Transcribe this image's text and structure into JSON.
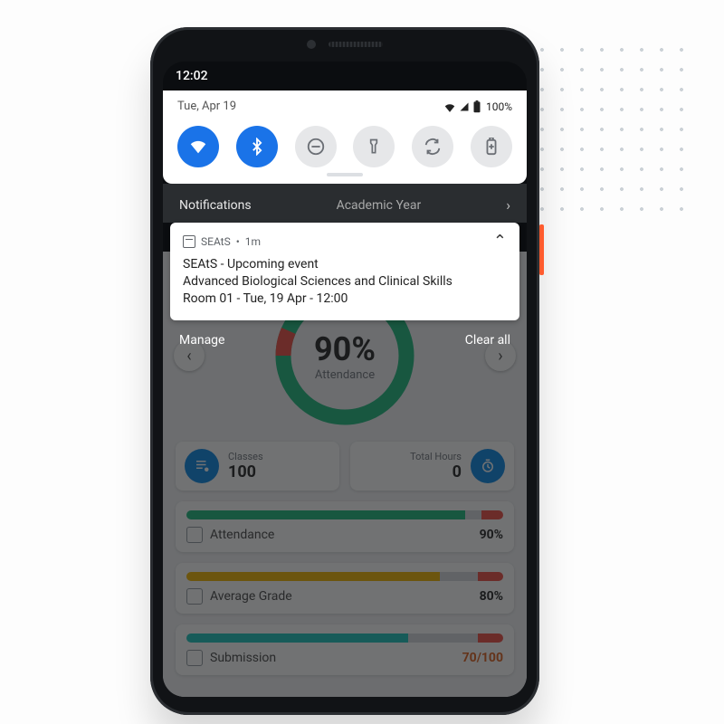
{
  "statusbar": {
    "time": "12:02"
  },
  "quicksettings": {
    "date": "Tue, Apr 19",
    "battery": "100%",
    "tiles": [
      {
        "name": "wifi-tile",
        "on": true
      },
      {
        "name": "bluetooth-tile",
        "on": true
      },
      {
        "name": "dnd-tile",
        "on": false
      },
      {
        "name": "flashlight-tile",
        "on": false
      },
      {
        "name": "rotate-tile",
        "on": false
      },
      {
        "name": "battery-saver-tile",
        "on": false
      }
    ]
  },
  "notifications": {
    "header_label": "Notifications",
    "background_tab": "Academic Year",
    "manage": "Manage",
    "clear_all": "Clear all",
    "card": {
      "app": "SEAtS",
      "age": "1m",
      "title": "SEAtS - Upcoming event",
      "line2": "Advanced Biological Sciences and Clinical Skills",
      "line3": "Room 01 - Tue, 19 Apr - 12:00"
    }
  },
  "dashboard": {
    "gauge": {
      "value": "90%",
      "label": "Attendance"
    },
    "stats": {
      "classes": {
        "label": "Classes",
        "value": "100"
      },
      "hours": {
        "label": "Total Hours",
        "value": "0"
      }
    },
    "metrics": [
      {
        "name": "Attendance",
        "value": "90%",
        "green": 0.88,
        "gray": 0.05,
        "red": 0.07
      },
      {
        "name": "Average Grade",
        "value": "80%",
        "yellow": 0.8,
        "gray": 0.12,
        "red": 0.08
      },
      {
        "name": "Submission",
        "value": "70/100",
        "teal": 0.7,
        "gray": 0.22,
        "red": 0.08
      }
    ]
  },
  "colors": {
    "accent": "#1a73e8",
    "green": "#2bbf87",
    "yellow": "#f2b90f",
    "teal": "#29c8c1",
    "red": "#f05a4f",
    "gray": "#d9dcdf"
  }
}
